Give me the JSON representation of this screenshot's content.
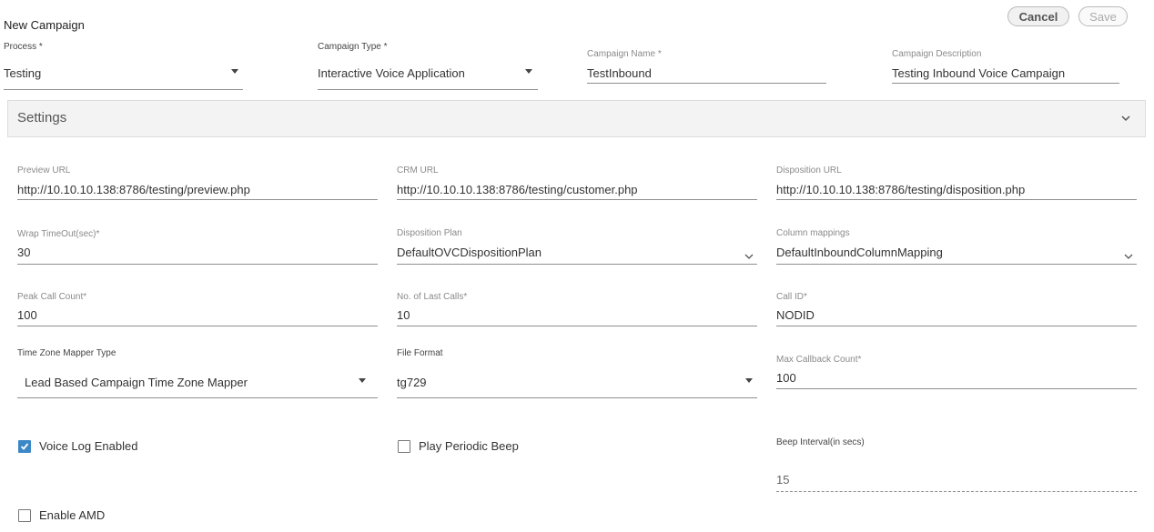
{
  "header": {
    "title": "New Campaign",
    "cancel_label": "Cancel",
    "save_label": "Save"
  },
  "top_fields": {
    "process": {
      "label": "Process *",
      "value": "Testing"
    },
    "campaign_type": {
      "label": "Campaign Type *",
      "value": "Interactive Voice Application"
    },
    "campaign_name": {
      "label": "Campaign Name *",
      "value": "TestInbound"
    },
    "campaign_description": {
      "label": "Campaign Description",
      "value": "Testing Inbound Voice Campaign"
    }
  },
  "settings": {
    "title": "Settings",
    "preview_url": {
      "label": "Preview URL",
      "value": "http://10.10.10.138:8786/testing/preview.php"
    },
    "crm_url": {
      "label": "CRM URL",
      "value": "http://10.10.10.138:8786/testing/customer.php"
    },
    "disposition_url": {
      "label": "Disposition URL",
      "value": "http://10.10.10.138:8786/testing/disposition.php"
    },
    "wrap_timeout": {
      "label": "Wrap TimeOut(sec)*",
      "value": "30"
    },
    "disposition_plan": {
      "label": "Disposition Plan",
      "value": "DefaultOVCDispositionPlan"
    },
    "column_mappings": {
      "label": "Column mappings",
      "value": "DefaultInboundColumnMapping"
    },
    "peak_call_count": {
      "label": "Peak Call Count*",
      "value": "100"
    },
    "last_calls": {
      "label": "No. of Last Calls*",
      "value": "10"
    },
    "call_id": {
      "label": "Call ID*",
      "value": "NODID"
    },
    "tz_mapper": {
      "label": "Time Zone Mapper Type",
      "value": "Lead Based Campaign Time Zone Mapper"
    },
    "file_format": {
      "label": "File Format",
      "value": "tg729"
    },
    "max_callback": {
      "label": "Max Callback Count*",
      "value": "100"
    },
    "voice_log": {
      "label": "Voice Log Enabled",
      "checked": true
    },
    "periodic_beep": {
      "label": "Play Periodic Beep",
      "checked": false
    },
    "beep_interval": {
      "label": "Beep Interval(in secs)",
      "value": "15"
    },
    "enable_amd": {
      "label": "Enable AMD",
      "checked": false
    }
  },
  "colors": {
    "accent": "#3c87c6",
    "settings_bg": "#f3f3f3"
  }
}
